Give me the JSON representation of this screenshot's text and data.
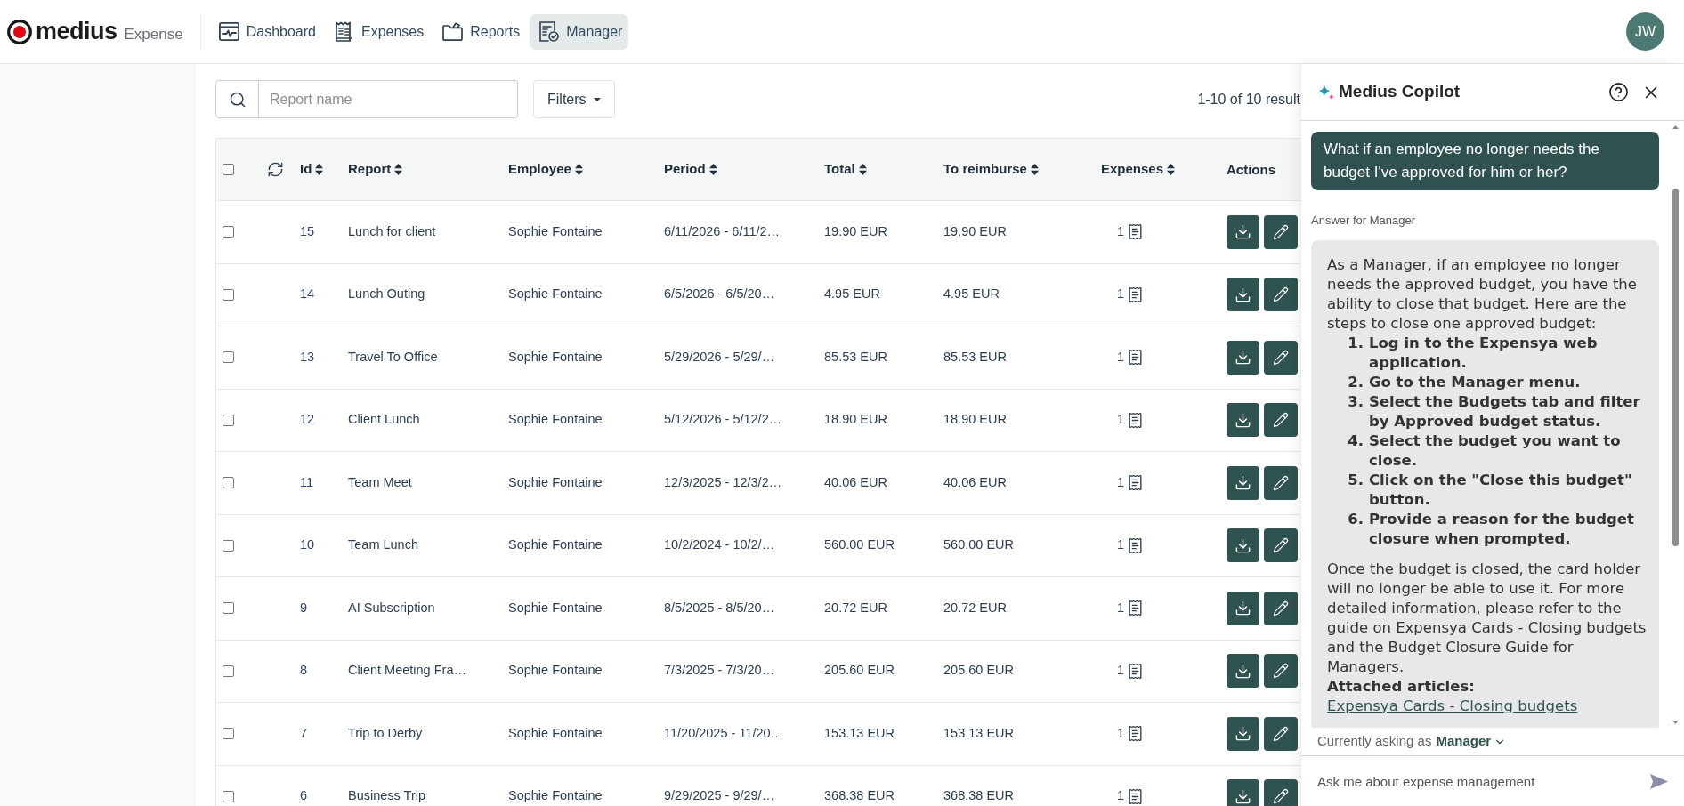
{
  "app": {
    "logo": "medius",
    "product": "Expense"
  },
  "nav": [
    {
      "label": "Dashboard",
      "selected": false
    },
    {
      "label": "Expenses",
      "selected": false
    },
    {
      "label": "Reports",
      "selected": false
    },
    {
      "label": "Manager",
      "selected": true
    }
  ],
  "user": {
    "initials": "JW"
  },
  "search": {
    "placeholder": "Report name"
  },
  "filters": {
    "label": "Filters"
  },
  "results": "1-10 of 10 result",
  "table": {
    "select_all": {
      "checked": false
    },
    "columns": [
      {
        "label": "Id",
        "sortable": true
      },
      {
        "label": "Report",
        "sortable": true
      },
      {
        "label": "Employee",
        "sortable": true
      },
      {
        "label": "Period",
        "sortable": true
      },
      {
        "label": "Total",
        "sortable": true
      },
      {
        "label": "To reimburse",
        "sortable": true
      },
      {
        "label": "Expenses",
        "sortable": true
      },
      {
        "label": "Actions",
        "sortable": false
      }
    ],
    "rows": [
      {
        "checked": false,
        "id": "15",
        "report": "Lunch for client",
        "employee": "Sophie Fontaine",
        "period": "6/11/2026 - 6/11/2…",
        "total": "19.90 EUR",
        "to_reimburse": "19.90 EUR",
        "expenses": "1"
      },
      {
        "checked": false,
        "id": "14",
        "report": "Lunch Outing",
        "employee": "Sophie Fontaine",
        "period": "6/5/2026 - 6/5/20…",
        "total": "4.95 EUR",
        "to_reimburse": "4.95 EUR",
        "expenses": "1"
      },
      {
        "checked": false,
        "id": "13",
        "report": "Travel To Office",
        "employee": "Sophie Fontaine",
        "period": "5/29/2026 - 5/29/…",
        "total": "85.53 EUR",
        "to_reimburse": "85.53 EUR",
        "expenses": "1"
      },
      {
        "checked": false,
        "id": "12",
        "report": "Client Lunch",
        "employee": "Sophie Fontaine",
        "period": "5/12/2026 - 5/12/2…",
        "total": "18.90 EUR",
        "to_reimburse": "18.90 EUR",
        "expenses": "1"
      },
      {
        "checked": false,
        "id": "11",
        "report": "Team Meet",
        "employee": "Sophie Fontaine",
        "period": "12/3/2025 - 12/3/2…",
        "total": "40.06 EUR",
        "to_reimburse": "40.06 EUR",
        "expenses": "1"
      },
      {
        "checked": false,
        "id": "10",
        "report": "Team Lunch",
        "employee": "Sophie Fontaine",
        "period": "10/2/2024 - 10/2/…",
        "total": "560.00 EUR",
        "to_reimburse": "560.00 EUR",
        "expenses": "1"
      },
      {
        "checked": false,
        "id": "9",
        "report": "AI Subscription",
        "employee": "Sophie Fontaine",
        "period": "8/5/2025 - 8/5/20…",
        "total": "20.72 EUR",
        "to_reimburse": "20.72 EUR",
        "expenses": "1"
      },
      {
        "checked": false,
        "id": "8",
        "report": "Client Meeting Fra…",
        "employee": "Sophie Fontaine",
        "period": "7/3/2025 - 7/3/20…",
        "total": "205.60 EUR",
        "to_reimburse": "205.60 EUR",
        "expenses": "1"
      },
      {
        "checked": false,
        "id": "7",
        "report": "Trip to Derby",
        "employee": "Sophie Fontaine",
        "period": "11/20/2025 - 11/20…",
        "total": "153.13 EUR",
        "to_reimburse": "153.13 EUR",
        "expenses": "1"
      },
      {
        "checked": false,
        "id": "6",
        "report": "Business Trip",
        "employee": "Sophie Fontaine",
        "period": "9/29/2025 - 9/29/…",
        "total": "368.38 EUR",
        "to_reimburse": "368.38 EUR",
        "expenses": "1"
      }
    ]
  },
  "copilot": {
    "title": "Medius Copilot",
    "question": "What if an employee no longer needs the budget I've approved for him or her?",
    "answer_label": "Answer for Manager",
    "answer": {
      "intro": "As a Manager, if an employee no longer needs the approved budget, you have the ability to close that budget. Here are the steps to close one approved budget:",
      "steps": [
        {
          "number": "1.",
          "text": "Log in to the Expensya web application."
        },
        {
          "number": "2.",
          "text": "Go to the Manager menu."
        },
        {
          "number": "3.",
          "text": "Select the Budgets tab and filter by Approved budget status."
        },
        {
          "number": "4.",
          "text": "Select the budget you want to close."
        },
        {
          "number": "5.",
          "text": "Click on the \"Close this budget\" button."
        },
        {
          "number": "6.",
          "text": "Provide a reason for the budget closure when prompted."
        }
      ],
      "outro": "Once the budget is closed, the card holder will no longer be able to use it. For more detailed information, please refer to the guide on Expensya Cards - Closing budgets and the Budget Closure Guide for Managers.",
      "attachments_heading": "Attached articles:",
      "articles": [
        "Expensya Cards - Closing budgets"
      ]
    },
    "role_prompt": "Currently asking as",
    "role": "Manager",
    "input": {
      "placeholder": "Ask me about expense management"
    }
  }
}
